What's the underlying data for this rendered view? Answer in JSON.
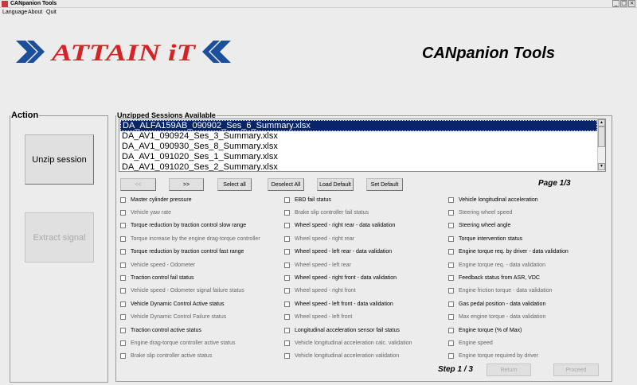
{
  "window": {
    "title": "CANpanion Tools",
    "minimize": "_",
    "maximize": "□",
    "close": "×"
  },
  "menu": [
    "Language",
    "About",
    "Quit"
  ],
  "logo": {
    "text": "ATTAIN iT",
    "colors": {
      "chevron": "#1b4f9c",
      "letters": "#d42427"
    }
  },
  "app_title": "CANpanion Tools",
  "action": {
    "legend": "Action",
    "unzip_label": "Unzip session",
    "extract_label": "Extract signal"
  },
  "sessions": {
    "legend": "Unzipped Sessions Available",
    "items": [
      "DA_ALFA159AB_090902_Ses_6_Summary.xlsx",
      "DA_AV1_090924_Ses_3_Summary.xlsx",
      "DA_AV1_090930_Ses_8_Summary.xlsx",
      "DA_AV1_091020_Ses_1_Summary.xlsx",
      "DA_AV1_091020_Ses_2_Summary.xlsx"
    ],
    "selected_index": 0,
    "scroll_up": "▲",
    "scroll_down": "▼"
  },
  "toolbar": {
    "prev": "<<",
    "next": ">>",
    "select_all": "Select all",
    "deselect_all": "Deselect All",
    "load_default": "Load Default",
    "set_default": "Set Default"
  },
  "page_label": "Page 1/3",
  "signals": {
    "col1": [
      "Master cylinder pressure",
      "Vehicle yaw rate",
      "Torque reduction by traction control slow range",
      "Torque increase by the engine drag-torque controller",
      "Torque reduction by traction control fast range",
      "Vehicle speed - Odometer",
      "Traction control fail status",
      "Vehicle speed - Odometer signal failure status",
      "Vehicle Dynamic Control Active status",
      "Vehicle Dynamic Control Failure status",
      "Traction control active status",
      "Engine drag-torque controller active status",
      "Brake slip controller active status"
    ],
    "col2": [
      "EBD fail status",
      "Brake slip controller fail status",
      "Wheel speed - right rear - data validation",
      "Wheel speed - right rear",
      "Wheel speed - left rear - data validation",
      "Wheel speed - left rear",
      "Wheel speed - right front - data validation",
      "Wheel speed - right front",
      "Wheel speed - left front - data validation",
      "Wheel speed - left front",
      "Longitudinal acceleration sensor fail status",
      "Vehicle longitudinal acceleration calc. validation",
      "Vehicle longitudinal acceleration validation"
    ],
    "col3": [
      "Vehicle longitudinal acceleration",
      "Steering wheel speed",
      "Steering wheel angle",
      "Torque intervention status",
      "Engine torque req. by driver - data validation",
      "Engine torque req. - data validation",
      "Feedback status from ASR, VDC",
      "Engine friction torque - data validation",
      "Gas pedal position - data validation",
      "Max engine torque - data validation",
      "Engine torque (% of Max)",
      "Engine speed",
      "Engine torque required by driver"
    ]
  },
  "step_label": "Step 1 / 3",
  "nav": {
    "return": "Return",
    "proceed": "Proceed"
  }
}
